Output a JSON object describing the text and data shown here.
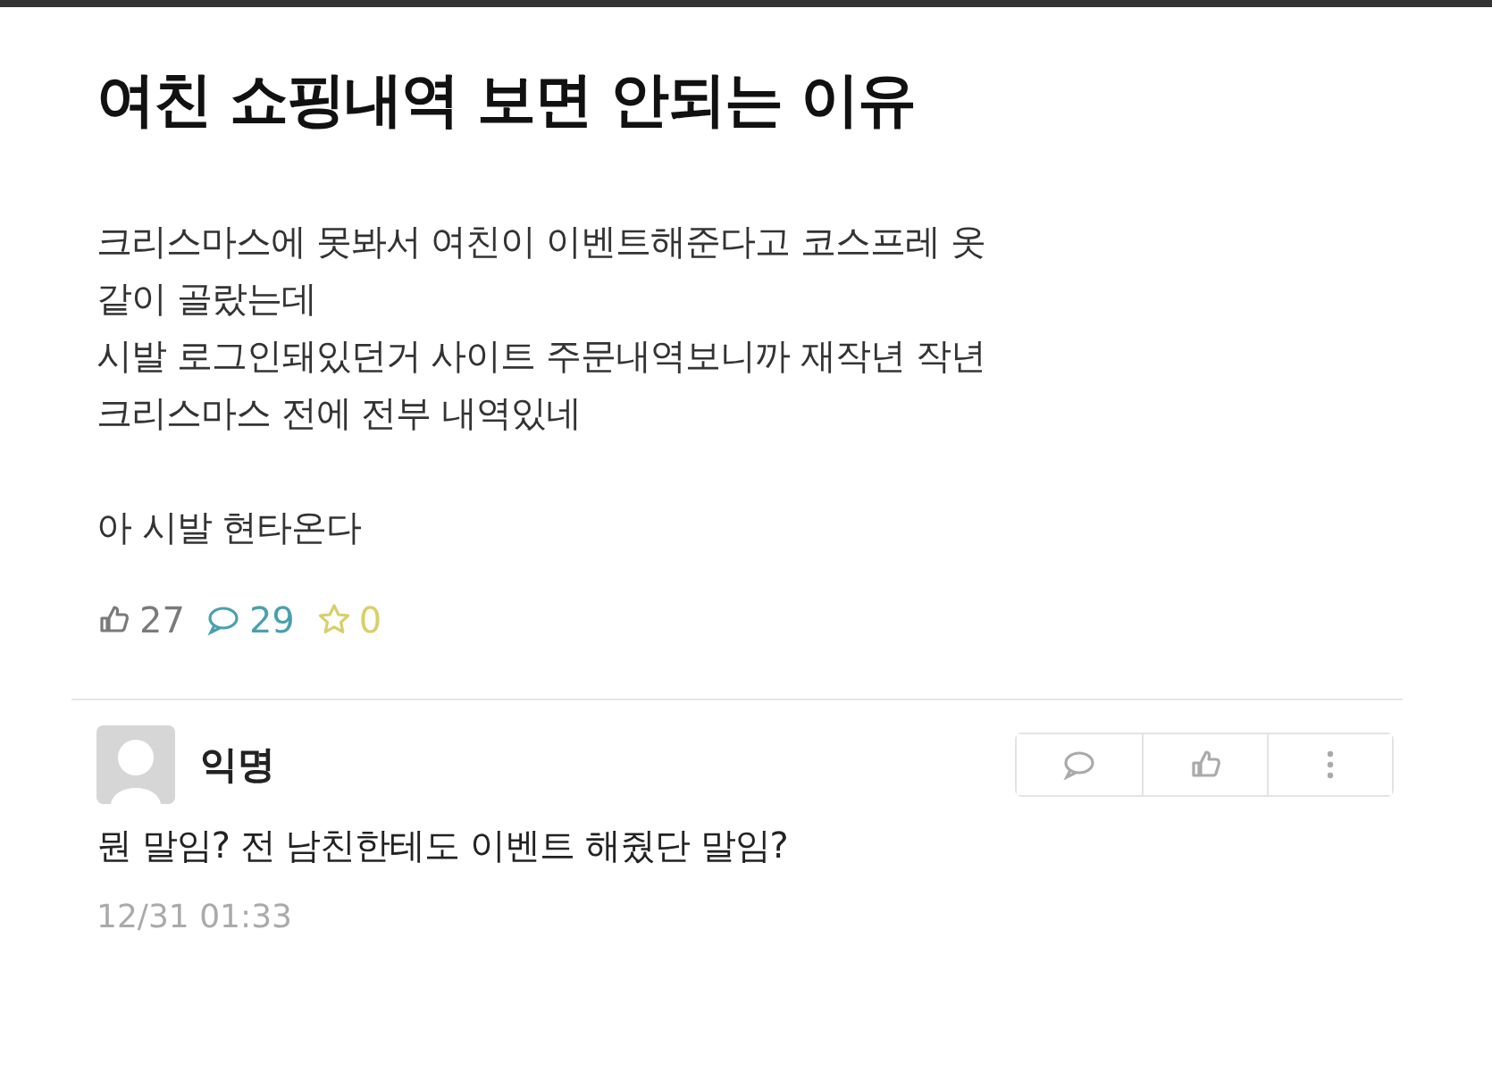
{
  "post": {
    "title": "여친 쇼핑내역 보면 안되는 이유",
    "paragraphs": [
      [
        "크리스마스에 못봐서 여친이 이벤트해준다고 코스프레 옷",
        "같이 골랐는데",
        "시발 로그인돼있던거 사이트 주문내역보니까 재작년 작년",
        "크리스마스 전에 전부 내역있네"
      ],
      [
        "아 시발 현타온다"
      ]
    ],
    "stats": [
      {
        "kind": "like",
        "count": "27",
        "color": "#7a7a7a"
      },
      {
        "kind": "comment",
        "count": "29",
        "color": "#4aa0ae"
      },
      {
        "kind": "scrap",
        "count": "0",
        "color": "#d9cf6a"
      }
    ]
  },
  "comment": {
    "author": "익명",
    "text": "뭔 말임? 전 남친한테도 이벤트 해줬단 말임?",
    "time": "12/31 01:33",
    "actions": [
      {
        "kind": "reply"
      },
      {
        "kind": "like"
      },
      {
        "kind": "more"
      }
    ]
  }
}
